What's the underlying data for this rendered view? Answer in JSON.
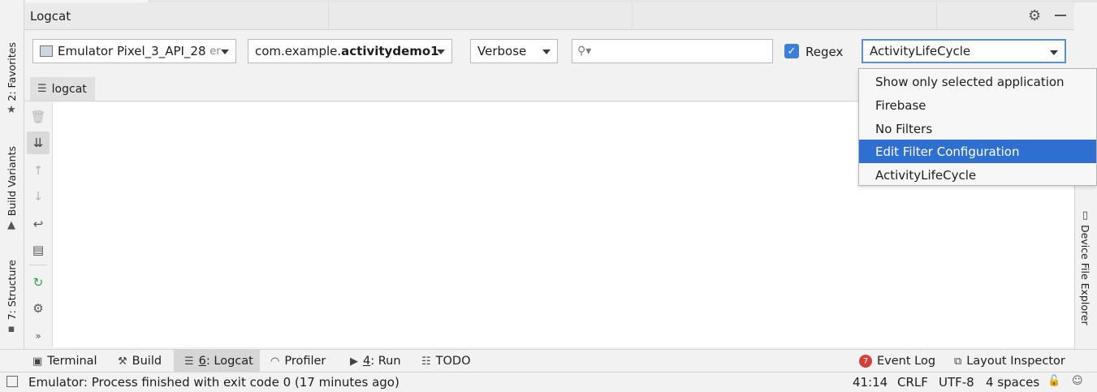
{
  "panel": {
    "title": "Logcat"
  },
  "left_tabs": {
    "favorites": "2: Favorites",
    "build_variants": "Build Variants",
    "structure": "7: Structure"
  },
  "right_tabs": {
    "device_file_explorer": "Device File Explorer"
  },
  "toolbar": {
    "device": "Emulator Pixel_3_API_28",
    "device_suffix": "er",
    "package_prefix": "com.example.",
    "package_bold": "activitydemo1",
    "log_level": "Verbose",
    "search_value": "",
    "regex_label": "Regex",
    "regex_checked": true,
    "filter": "ActivityLifeCycle"
  },
  "inner_tab": {
    "label": "logcat"
  },
  "filter_menu": {
    "items": [
      "Show only selected application",
      "Firebase",
      "No Filters",
      "Edit Filter Configuration",
      "ActivityLifeCycle"
    ],
    "selected_index": 3
  },
  "bottom_tabs": {
    "terminal": "Terminal",
    "build": "Build",
    "logcat_num": "6",
    "logcat": ": Logcat",
    "profiler": "Profiler",
    "run_num": "4",
    "run": ": Run",
    "todo": "TODO",
    "event_log_badge": "7",
    "event_log": "Event Log",
    "layout_inspector": "Layout Inspector"
  },
  "status_bar": {
    "message": "Emulator: Process finished with exit code 0 (17 minutes ago)",
    "position": "41:14",
    "line_sep": "CRLF",
    "encoding": "UTF-8",
    "indent": "4 spaces"
  },
  "colors": {
    "accent": "#2f6fcf",
    "checkbox": "#3c7fd6",
    "badge": "#d43f3a"
  }
}
